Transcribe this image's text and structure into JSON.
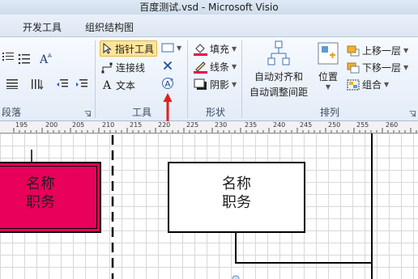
{
  "window": {
    "title": "百度测试.vsd  -  Microsoft Visio"
  },
  "menu": {
    "tabs": [
      "开发工具",
      "组织结构图"
    ]
  },
  "ribbon": {
    "tools": {
      "pointer_label": "指针工具",
      "connector_label": "连接线",
      "text_label": "文本",
      "group_label": "工具"
    },
    "shape": {
      "fill_label": "填充",
      "line_label": "线条",
      "shadow_label": "阴影",
      "group_label": "形状"
    },
    "arrange": {
      "auto_align_label_1": "自动对齐和",
      "auto_align_label_2": "自动调整间距",
      "position_label": "位置",
      "bring_forward_label": "上移一层",
      "send_backward_label": "下移一层",
      "group_label": "组合",
      "section_label": "排列"
    },
    "paragraph": {
      "label": "段落"
    }
  },
  "ruler": {
    "labels": [
      "195",
      "200",
      "205",
      "210",
      "215",
      "220",
      "225",
      "230",
      "235",
      "240",
      "245",
      "250",
      "255",
      "260"
    ]
  },
  "canvas": {
    "shape1": {
      "line1": "名称",
      "line2": "职务"
    },
    "shape2": {
      "line1": "名称",
      "line2": "职务"
    }
  },
  "colors": {
    "accent_shape_fill": "#e8005a",
    "annotation_arrow": "#e02020",
    "selected_tool_bg": "#fde69a"
  }
}
